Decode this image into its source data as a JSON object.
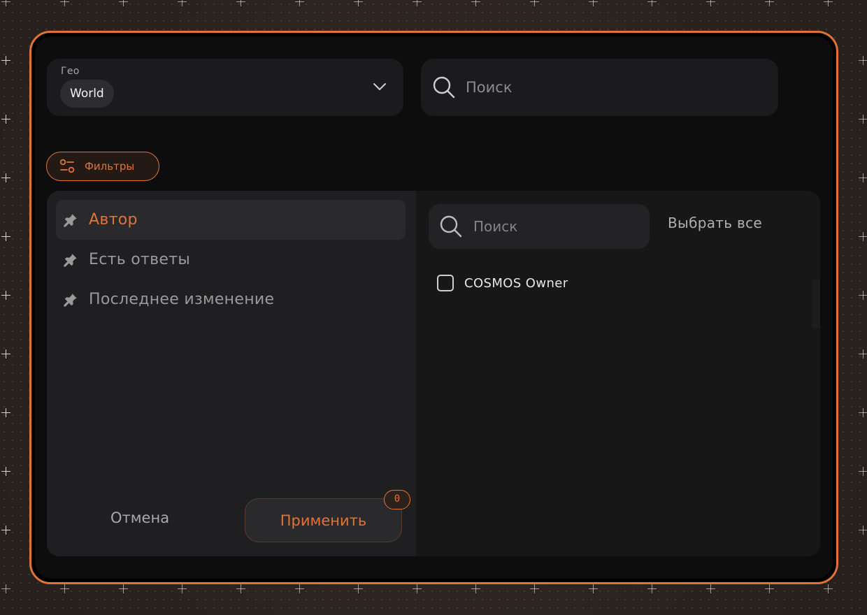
{
  "colors": {
    "accent": "#e0733a",
    "panel": "#1f1f21",
    "window": "#0d0d0e"
  },
  "geo": {
    "label": "Гео",
    "value": "World",
    "icon": "chevron-down-icon"
  },
  "top_search": {
    "placeholder": "Поиск",
    "icon": "search-icon"
  },
  "filters_button": {
    "label": "Фильтры",
    "icon": "sliders-icon"
  },
  "filter_list": {
    "items": [
      {
        "label": "Автор",
        "active": true,
        "icon": "pin-icon"
      },
      {
        "label": "Есть ответы",
        "active": false,
        "icon": "pin-icon"
      },
      {
        "label": "Последнее изменение",
        "active": false,
        "icon": "pin-icon"
      }
    ]
  },
  "actions": {
    "cancel_label": "Отмена",
    "apply_label": "Применить",
    "apply_count": "0"
  },
  "options_panel": {
    "search_placeholder": "Поиск",
    "select_all_label": "Выбрать все",
    "options": [
      {
        "label": "COSMOS Owner",
        "checked": false
      }
    ]
  }
}
